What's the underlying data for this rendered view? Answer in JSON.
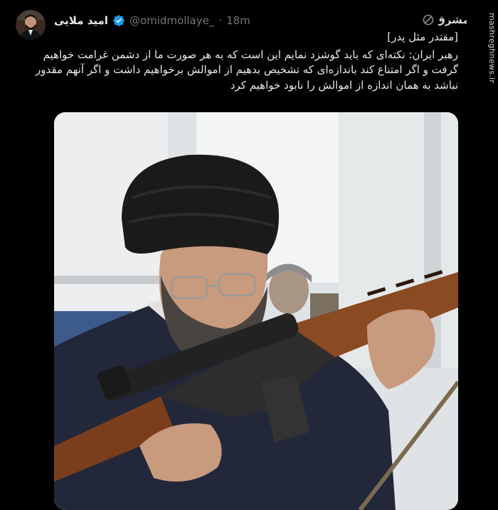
{
  "author": {
    "name": "امید ملایی",
    "handle": "@omidmollaye_",
    "separator": "·",
    "time": "18m",
    "verified": true
  },
  "watermark": {
    "site": "mashreghnews.ir",
    "logo_text": "مشرق"
  },
  "tweet": {
    "lines": [
      "[مقتدر مثل پدر]",
      "رهبر ایران: نکته‌ای که باید گوشزد نمایم این است که به هر صورت ما از دشمن غرامت خواهیم گرفت و اگر امتناع کند باندازه‌ای که تشخیص بدهیم از اموالش برخواهیم داشت و اگر آنهم مقدور نباشد به همان اندازه از اموالش را نابود خواهیم کرد"
    ]
  },
  "media": {
    "description_icon": "photo",
    "colors": {
      "background": "#d9dde0",
      "turban": "#1a1a1a",
      "robe": "#22283a",
      "wood": "#8a4a22",
      "skin": "#c89a7e"
    }
  },
  "colors": {
    "background": "#000000",
    "text": "#e7e9ea",
    "muted": "#71767b",
    "verified": "#1d9bf0"
  }
}
